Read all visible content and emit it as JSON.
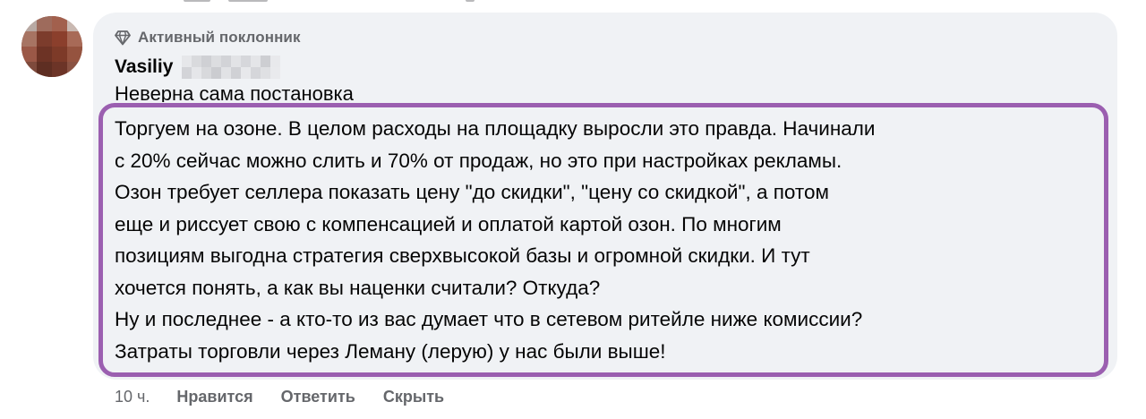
{
  "comment": {
    "badge": {
      "icon": "diamond-icon",
      "label": "Активный поклонник"
    },
    "author": {
      "name": "Vasiliy",
      "surname_redacted": true
    },
    "partial_first_line": "Неверна сама постановка",
    "text_lines": [
      "Торгуем на озоне. В целом расходы на площадку выросли это правда. Начинали",
      "с 20% сейчас можно слить и 70% от продаж, но это при настройках рекламы.",
      "Озон требует селлера показать цену \"до скидки\", \"цену со скидкой\", а потом",
      "еще и риссует свою с компенсацией и оплатой картой озон. По многим",
      "позициям выгодна стратегия сверхвысокой базы и огромной скидки. И тут",
      "хочется понять, а как вы наценки считали? Откуда?",
      "Ну и последнее - а кто-то из вас думает что в сетевом ритейле ниже комиссии?",
      "Затраты торговли через Леману (лерую) у нас были выше!"
    ],
    "timestamp": "10 ч.",
    "actions": {
      "like": "Нравится",
      "reply": "Ответить",
      "hide": "Скрыть"
    }
  },
  "colors": {
    "bubble_background": "#f0f2f5",
    "highlight_border": "#9b5fb0",
    "secondary_text": "#65676b",
    "primary_text": "#050505"
  }
}
